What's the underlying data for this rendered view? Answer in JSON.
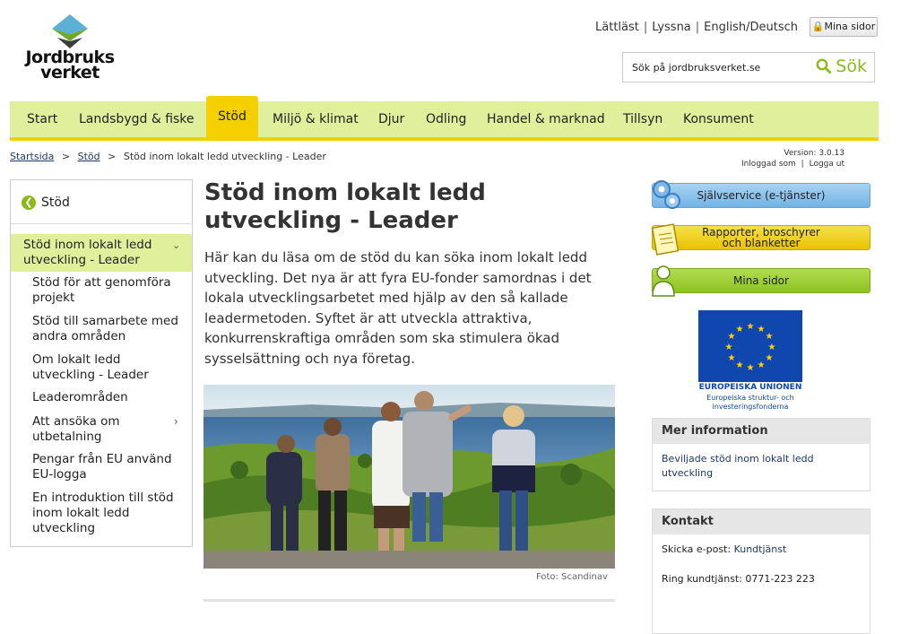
{
  "header": {
    "logo_line1": "Jordbruks",
    "logo_line2": "verket",
    "links": [
      "Lättläst",
      "Lyssna",
      "English/Deutsch"
    ],
    "mina_sidor": "Mina sidor",
    "search_placeholder": "Sök på jordbruksverket.se",
    "search_button": "Sök"
  },
  "nav": {
    "items": [
      "Start",
      "Landsbygd & fiske",
      "Stöd",
      "Miljö & klimat",
      "Djur",
      "Odling",
      "Handel & marknad",
      "Tillsyn",
      "Konsument"
    ],
    "active": "Stöd"
  },
  "breadcrumb": {
    "items": [
      "Startsida",
      "Stöd",
      "Stöd inom lokalt ledd utveckling - Leader"
    ],
    "separator": ">"
  },
  "status": {
    "version": "Version: 3.0.13",
    "logged_in": "Inloggad som",
    "logout": "Logga ut"
  },
  "sidebar": {
    "back_label": "Stöd",
    "current": "Stöd inom lokalt ledd utveckling - Leader",
    "items": [
      "Stöd för att genomföra projekt",
      "Stöd till samarbete med andra områden",
      "Om lokalt ledd utveckling - Leader",
      "Leaderområden",
      "Att ansöka om utbetalning",
      "Pengar från EU använd EU-logga",
      "En introduktion till stöd inom lokalt ledd utveckling"
    ]
  },
  "main": {
    "title": "Stöd inom lokalt ledd utveckling - Leader",
    "intro": "Här kan du läsa om de stöd du kan söka inom lokalt ledd utveckling. Det nya är att fyra EU-fonder samordnas i det lokala utvecklingsarbetet med hjälp av den så kallade leadermetoden. Syftet är att utveckla attraktiva, konkurrenskraftiga områden som ska stimulera ökad sysselsättning och nya företag.",
    "photo_credit": "Foto: Scandinav"
  },
  "right": {
    "btn_sjalvservice": "Självservice (e-tjänster)",
    "btn_rapporter": "Rapporter, broschyrer och blanketter",
    "btn_mina": "Mina sidor",
    "eu_line1": "EUROPEISKA UNIONEN",
    "eu_line2": "Europeiska struktur- och investeringsfonderna",
    "mer_title": "Mer information",
    "mer_link": "Beviljade stöd inom lokalt ledd utveckling",
    "kontakt_title": "Kontakt",
    "kontakt_email_label": "Skicka e-post:",
    "kontakt_email_link": "Kundtjänst",
    "kontakt_phone": "Ring kundtjänst: 0771-223 223"
  },
  "colors": {
    "nav_bg": "#e0ef9c",
    "nav_active": "#f4d000",
    "accent_green": "#8cb91a",
    "link": "#1d3a6b"
  }
}
